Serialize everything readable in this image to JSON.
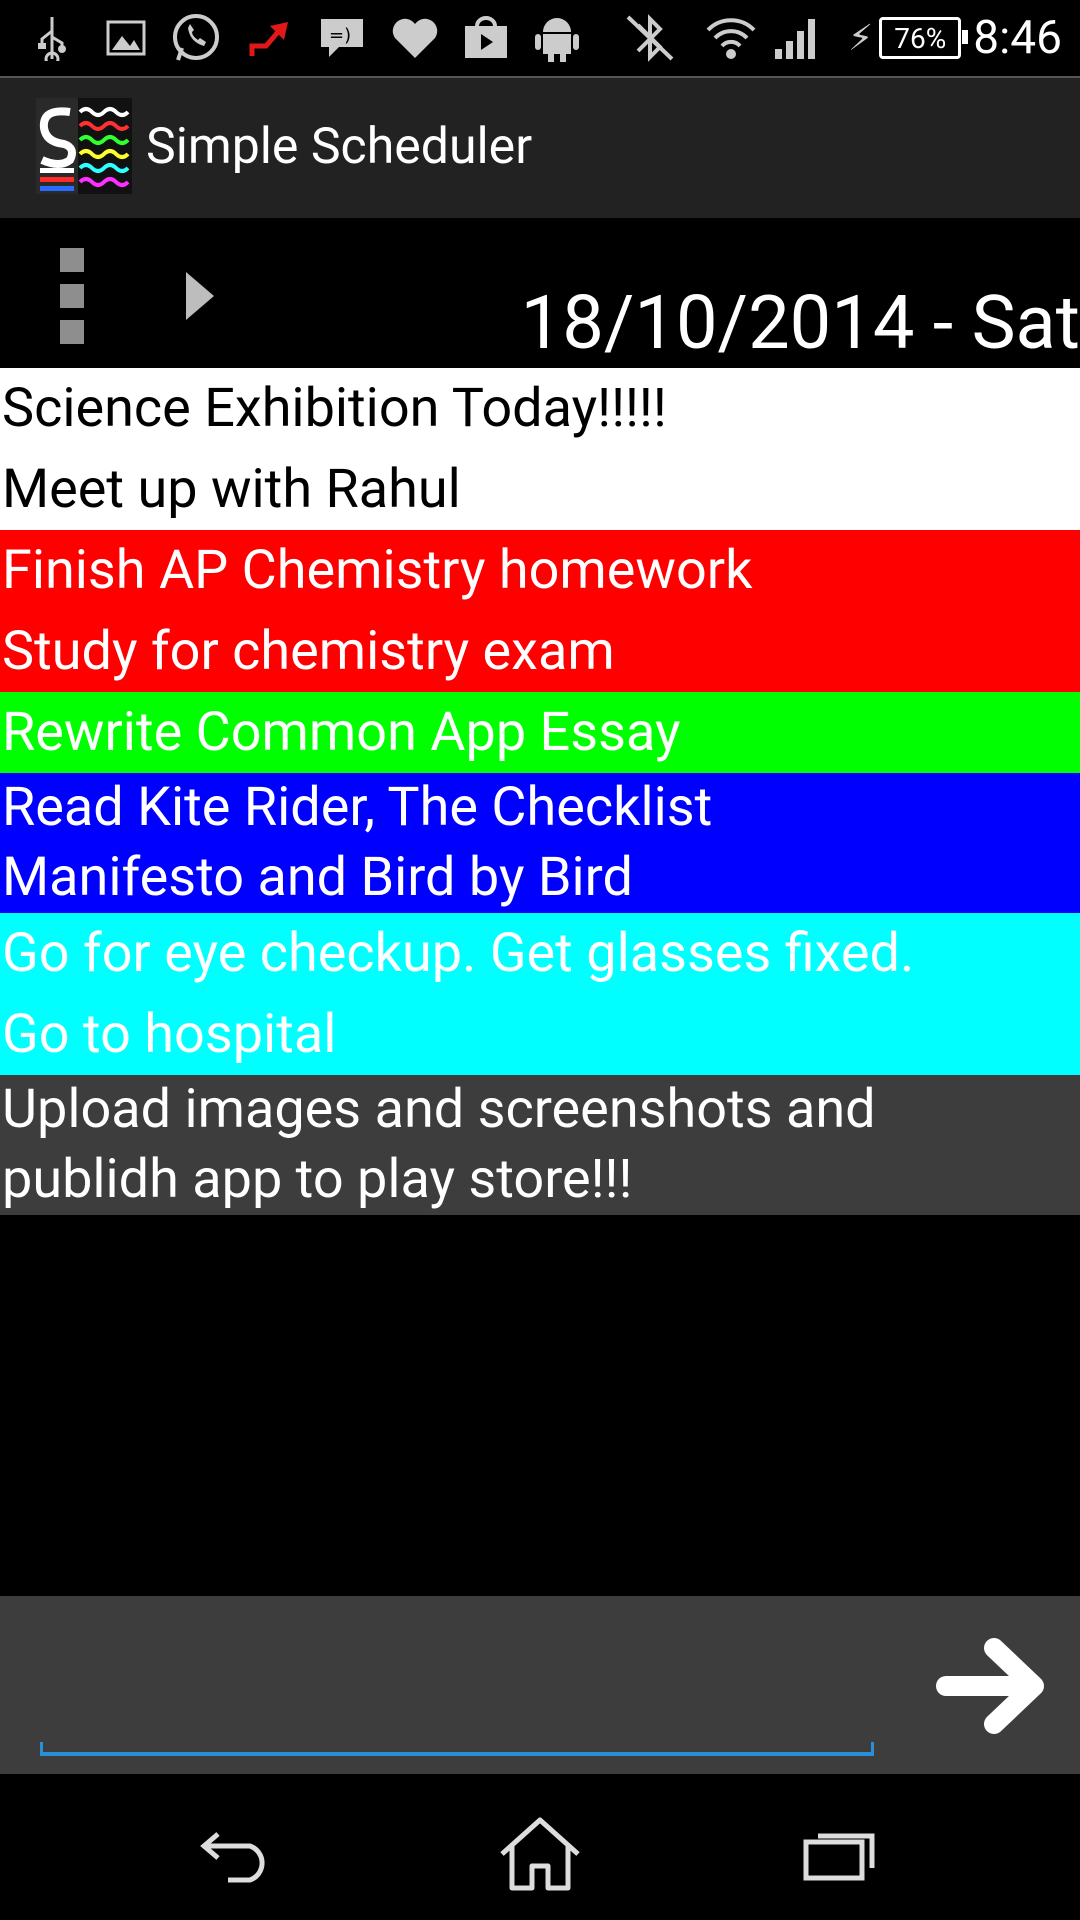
{
  "status_bar": {
    "battery": "76%",
    "time": "8:46",
    "icons": [
      "usb-icon",
      "image-icon",
      "whatsapp-icon",
      "upload-icon",
      "message-icon",
      "heart-icon",
      "shopping-bag-icon",
      "android-icon",
      "bluetooth-off-icon",
      "wifi-icon",
      "signal-icon",
      "charging-icon",
      "battery-icon"
    ]
  },
  "app": {
    "title": "Simple Scheduler"
  },
  "toolbar": {
    "date": "18/10/2014 - Sat"
  },
  "tasks": [
    {
      "lines": [
        "Science Exhibition Today!!!!!",
        "Meet up with Rahul"
      ],
      "bg": "#ffffff",
      "fg": "#000000"
    },
    {
      "lines": [
        "Finish AP Chemistry homework",
        "Study for chemistry exam"
      ],
      "bg": "#ff0000",
      "fg": "#ffffff"
    },
    {
      "lines": [
        "Rewrite Common App Essay"
      ],
      "bg": "#00ff00",
      "fg": "#ffffff"
    },
    {
      "lines": [
        "Read Kite Rider, The Checklist",
        "Manifesto and Bird by Bird"
      ],
      "bg": "#0000ff",
      "fg": "#ffffff"
    },
    {
      "lines": [
        "Go for eye checkup. Get glasses fixed.",
        "Go to hospital"
      ],
      "bg": "#00ffff",
      "fg": "#ffffff"
    },
    {
      "lines": [
        "Upload images and screenshots and",
        "publidh app to play store!!!"
      ],
      "bg": "#3d3d3d",
      "fg": "#ffffff"
    }
  ],
  "input": {
    "value": "",
    "placeholder": ""
  },
  "nav": {
    "icons": [
      "back-icon",
      "home-icon",
      "recent-apps-icon"
    ]
  },
  "colors": {
    "accent": "#2b8fd8"
  }
}
